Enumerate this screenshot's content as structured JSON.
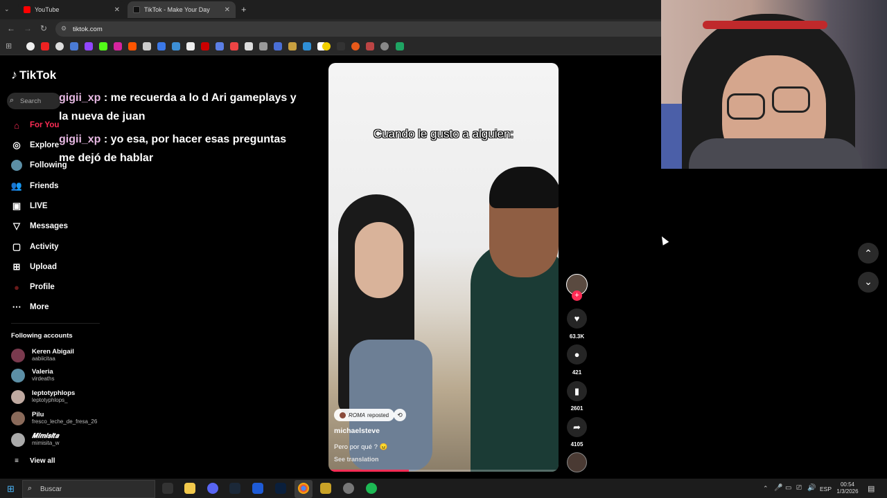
{
  "browser": {
    "tabs": [
      {
        "label": "YouTube",
        "active": false,
        "color": "#ff0000"
      },
      {
        "label": "TikTok - Make Your Day",
        "active": true,
        "color": "#000000"
      }
    ],
    "new_tab_label": "+",
    "url": "tiktok.com"
  },
  "tiktok": {
    "logo": "TikTok",
    "search_placeholder": "Search",
    "nav": [
      {
        "label": "For You",
        "icon": "home-icon",
        "active": true
      },
      {
        "label": "Explore",
        "icon": "compass-icon"
      },
      {
        "label": "Following",
        "icon": "following-avatar-icon"
      },
      {
        "label": "Friends",
        "icon": "friends-icon"
      },
      {
        "label": "LIVE",
        "icon": "live-icon"
      },
      {
        "label": "Messages",
        "icon": "messages-icon"
      },
      {
        "label": "Activity",
        "icon": "activity-icon"
      },
      {
        "label": "Upload",
        "icon": "upload-icon"
      },
      {
        "label": "Profile",
        "icon": "profile-icon"
      },
      {
        "label": "More",
        "icon": "more-icon"
      }
    ],
    "following_title": "Following accounts",
    "accounts": [
      {
        "name": "Keren Abigail",
        "user": "aabiicitaa"
      },
      {
        "name": "Valeria",
        "user": "virdeaths"
      },
      {
        "name": "leptotyphlops",
        "user": "leptotyphlops_"
      },
      {
        "name": "Pilu",
        "user": "fresco_leche_de_fresa_26"
      },
      {
        "name": "𝑴𝒊𝒎𝒊𝒔𝒊𝒕𝒂",
        "user": "mimisita_w"
      }
    ],
    "view_all": "View all"
  },
  "chat": [
    {
      "user": "gigii_xp",
      "sep": " : ",
      "line1": "me recuerda a lo d Ari gameplays y",
      "line2": "la nueva de juan"
    },
    {
      "user": "gigii_xp",
      "sep": " : ",
      "line1": "yo esa, por hacer esas preguntas",
      "line2": "me dejó de hablar"
    }
  ],
  "video": {
    "caption_overlay": "Cuando le gusto a alguien:",
    "reposted_by": "ROMA",
    "reposted_label": "reposted",
    "author": "michaelsteve",
    "description": "Pero por qué ? 😠",
    "see_translation": "See translation",
    "progress": 0.35
  },
  "actions": {
    "likes": "63.3K",
    "comments": "421",
    "saves": "2601",
    "shares": "4105"
  },
  "taskbar": {
    "search_placeholder": "Buscar",
    "lang": "ESP",
    "time": "00:54",
    "date": "1/3/2026"
  }
}
